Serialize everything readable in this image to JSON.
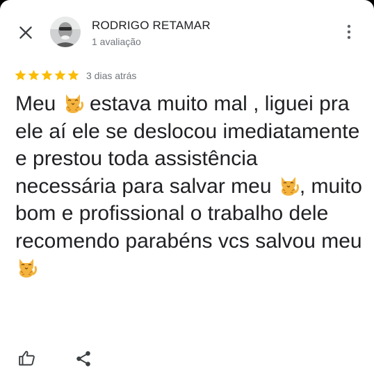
{
  "review": {
    "author": {
      "name": "RODRIGO RETAMAR",
      "meta": "1 avaliação"
    },
    "rating": 5,
    "date": "3 dias atrás",
    "text_parts": [
      "Meu ",
      " estava muito mal , liguei pra ele aí ele se deslocou imediatamente e prestou toda assistência necessária para salvar meu ",
      ", muito bom e profissional o trabalho dele recomendo parabéns vcs salvou meu "
    ],
    "emoji": "cat-icon"
  },
  "actions": {
    "close": "close-icon",
    "more": "more-vert-icon",
    "like": "thumb-up-icon",
    "share": "share-icon"
  },
  "colors": {
    "star": "#fbbc04",
    "text": "#202124",
    "secondary": "#70757a",
    "icon": "#3c4043"
  }
}
